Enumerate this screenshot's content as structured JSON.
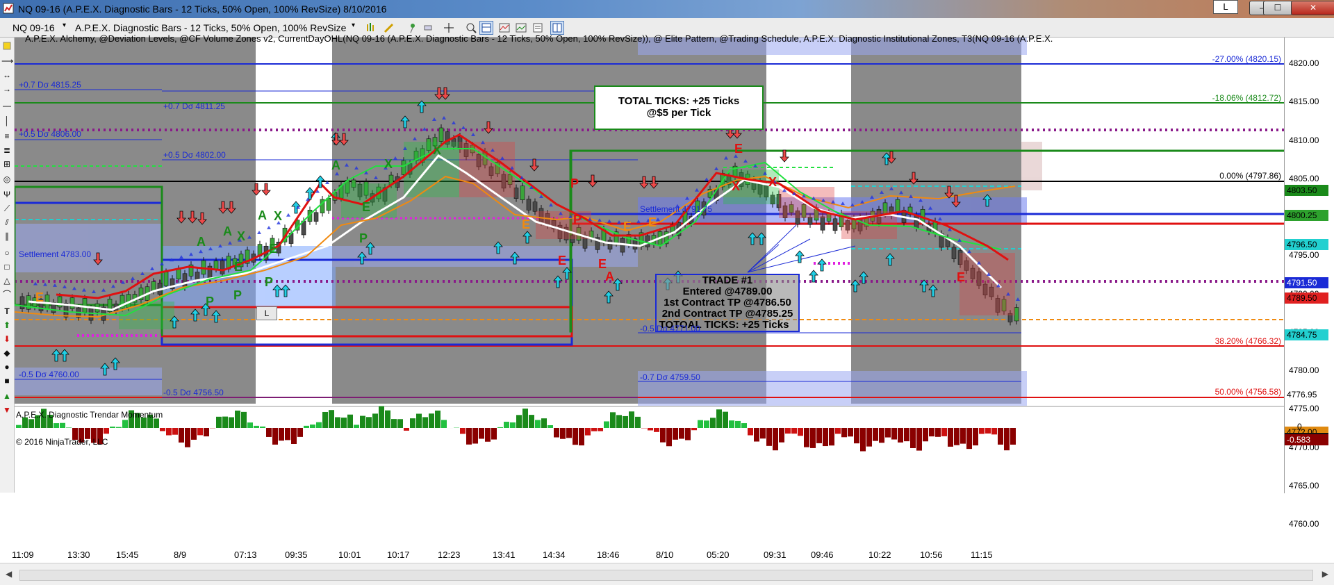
{
  "window": {
    "title": "NQ 09-16 (A.P.E.X. Diagnostic Bars - 12 Ticks, 50% Open, 100% RevSize)  8/10/2016",
    "link_button": "L",
    "minimize": "—",
    "maximize": "☐",
    "close": "✕"
  },
  "toolbar": {
    "instrument": "NQ 09-16",
    "bar_type": "A.P.E.X. Diagnostic Bars - 12 Ticks, 50% Open, 100% RevSize"
  },
  "chart": {
    "indicator_line": "A.P.E.X. Alchemy, @Deviation Levels, @CF Volume Zones v2, CurrentDayOHL(NQ 09-16 (A.P.E.X. Diagnostic Bars - 12 Ticks, 50% Open, 100% RevSize)), @ Elite Pattern, @Trading Schedule, A.P.E.X. Diagnostic Institutional Zones, T3(NQ 09-16 (A.P.E.X. Diagnostic Bars - 12 Ticks, 50% Op",
    "panel2_label": "A.P.E.X. Diagnostic Trendar Momentum",
    "copyright": "© 2016 NinjaTrader, LLC",
    "total_box": {
      "line1": "TOTAL TICKS: +25 Ticks",
      "line2": "@$5 per Tick"
    },
    "trade_box": {
      "line1": "TRADE #1",
      "line2": "Entered @4789.00",
      "line3": "1st Contract TP @4786.50",
      "line4": "2nd Contract TP @4785.25",
      "line5": "TOTOAL TICKS: +25 Ticks"
    },
    "order_tag": "L",
    "level_labels": {
      "p07_4815": "+0.7 Dσ 4815.25",
      "p07_4811": "+0.7 Dσ 4811.25",
      "p05_4806": "+0.5 Dσ 4806.00",
      "p05_4802": "+0.5 Dσ 4802.00",
      "settle_left": "Settlement 4783.00",
      "m05_4760": "-0.5 Dσ 4760.00",
      "m05_4756": "-0.5 Dσ 4756.50",
      "settle_mid": "Settlement 4791.75",
      "m05_4771": "-0.5 Dσ 4771.00",
      "m07_4759": "-0.7 Dσ 4759.50",
      "fib_m27": "-27.00% (4820.15)",
      "fib_m18": "-18.06% (4812.72)",
      "fib_0": "0.00% (4797.86)",
      "fib_382": "38.20% (4766.32)",
      "fib_50": "50.00% (4756.58)"
    },
    "pattern_letters": [
      "E",
      "A",
      "A",
      "X",
      "A",
      "X",
      "E",
      "E",
      "P",
      "P",
      "P",
      "E",
      "A",
      "X",
      "X",
      "P",
      "E",
      "P",
      "E",
      "E",
      "A",
      "X",
      "E",
      "E",
      "E",
      "P",
      "E",
      "X"
    ]
  },
  "price_axis": {
    "ticks": [
      "4820.00",
      "4815.00",
      "4810.00",
      "4805.00",
      "4800.00",
      "4795.00",
      "4790.00",
      "4785.00",
      "4780.00",
      "4775.00",
      "4770.00",
      "4765.00",
      "4760.00"
    ],
    "labels": [
      {
        "text": "4803.50",
        "bg": "#1a8a1a",
        "fg": "#000000"
      },
      {
        "text": "4800.25",
        "bg": "#2da12d",
        "fg": "#000000"
      },
      {
        "text": "4796.50",
        "bg": "#22d0d0",
        "fg": "#000000"
      },
      {
        "text": "4791.50",
        "bg": "#1a2ad6",
        "fg": "#ffffff"
      },
      {
        "text": "4789.50",
        "bg": "#e02020",
        "fg": "#000000"
      },
      {
        "text": "4784.75",
        "bg": "#22d0d0",
        "fg": "#000000"
      },
      {
        "text": "4776.95",
        "bg": "#ffffff",
        "fg": "#000000"
      },
      {
        "text": "4772.00",
        "bg": "#e08a10",
        "fg": "#000000"
      },
      {
        "text": "4771.25",
        "bg": "#111111",
        "fg": "#ffffff"
      }
    ],
    "momentum_zero": "0",
    "momentum_value": "-0.583"
  },
  "time_axis": {
    "ticks": [
      "11:09",
      "13:30",
      "15:45",
      "8/9",
      "07:13",
      "09:35",
      "10:01",
      "10:17",
      "12:23",
      "13:41",
      "14:34",
      "18:46",
      "8/10",
      "05:20",
      "09:31",
      "09:46",
      "10:22",
      "10:56",
      "11:15"
    ]
  },
  "colors": {
    "session_gray": "#8a8a8a",
    "up_arrow": "#22cce6",
    "down_arrow": "#ee4040",
    "green": "#1a8a1a",
    "red": "#e01010",
    "blue": "#1a2ad6",
    "orange": "#f08a10",
    "magenta": "#e020e0",
    "purple": "#8a1a8a"
  }
}
